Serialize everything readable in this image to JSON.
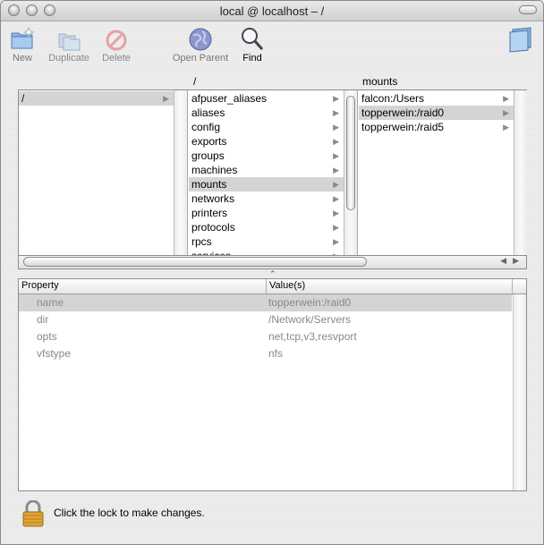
{
  "window": {
    "title": "local @ localhost – /"
  },
  "toolbar": {
    "new_label": "New",
    "duplicate_label": "Duplicate",
    "delete_label": "Delete",
    "open_parent_label": "Open Parent",
    "find_label": "Find"
  },
  "browser": {
    "column1_header": "/",
    "column2_header": "mounts",
    "column0_items": [
      {
        "label": "/"
      }
    ],
    "column1_items": [
      {
        "label": "afpuser_aliases"
      },
      {
        "label": "aliases"
      },
      {
        "label": "config"
      },
      {
        "label": "exports"
      },
      {
        "label": "groups"
      },
      {
        "label": "machines"
      },
      {
        "label": "mounts",
        "selected": true
      },
      {
        "label": "networks"
      },
      {
        "label": "printers"
      },
      {
        "label": "protocols"
      },
      {
        "label": "rpcs"
      },
      {
        "label": "services"
      }
    ],
    "column2_items": [
      {
        "label": "falcon:/Users"
      },
      {
        "label": "topperwein:/raid0",
        "selected": true
      },
      {
        "label": "topperwein:/raid5"
      }
    ]
  },
  "properties": {
    "col_property": "Property",
    "col_value": "Value(s)",
    "rows": [
      {
        "property": "name",
        "value": "topperwein:/raid0",
        "selected": true
      },
      {
        "property": "dir",
        "value": "/Network/Servers"
      },
      {
        "property": "opts",
        "value": "net,tcp,v3,resvport"
      },
      {
        "property": "vfstype",
        "value": "nfs"
      }
    ]
  },
  "status": {
    "lock_message": "Click the lock to make changes."
  }
}
